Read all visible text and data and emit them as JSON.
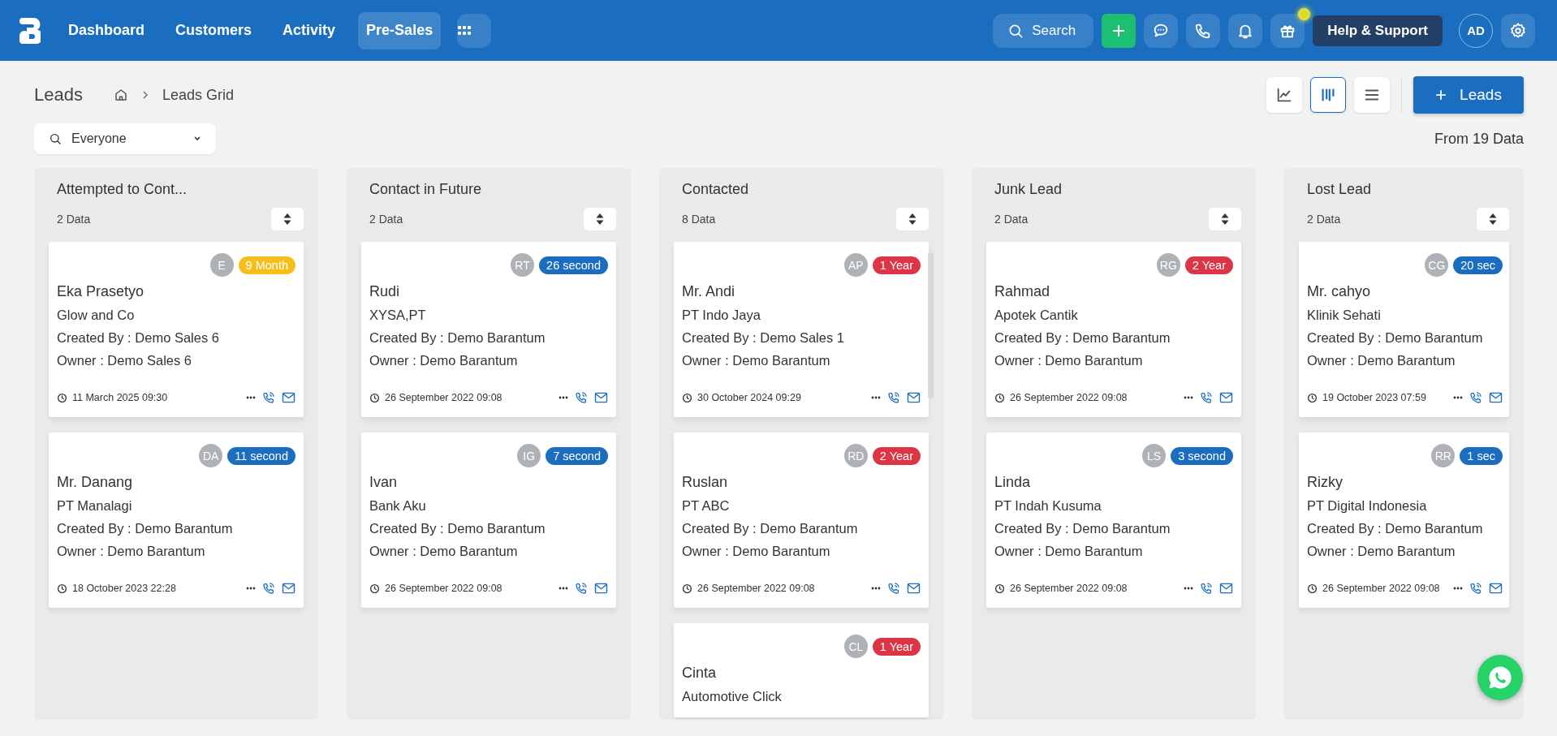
{
  "nav": {
    "items": [
      {
        "label": "Dashboard",
        "selected": false
      },
      {
        "label": "Customers",
        "selected": false
      },
      {
        "label": "Activity",
        "selected": false
      },
      {
        "label": "Pre-Sales",
        "selected": true
      }
    ]
  },
  "topbar": {
    "search_label": "Search",
    "help_label": "Help & Support",
    "avatar": "AD",
    "gift_notification": true
  },
  "page": {
    "title": "Leads",
    "breadcrumb": "Leads Grid"
  },
  "views": [
    {
      "kind": "chart",
      "selected": false
    },
    {
      "kind": "kanban",
      "selected": true
    },
    {
      "kind": "list",
      "selected": false
    }
  ],
  "add_button": "Leads",
  "filter": {
    "value": "Everyone"
  },
  "total": "From 19 Data",
  "columns": [
    {
      "title": "Attempted to Cont...",
      "count": "2 Data",
      "cards": [
        {
          "initials": "E",
          "age": "9 Month",
          "color": "#f5bf1b",
          "name": "Eka Prasetyo",
          "company": "Glow and Co",
          "created_by": "Created By : Demo Sales 6",
          "owner": "Owner : Demo Sales 6",
          "date": "11 March 2025 09:30"
        },
        {
          "initials": "DA",
          "age": "11 second",
          "color": "#1b6ebf",
          "name": "Mr. Danang",
          "company": "PT Manalagi",
          "created_by": "Created By : Demo Barantum",
          "owner": "Owner : Demo Barantum",
          "date": "18 October 2023 22:28"
        }
      ]
    },
    {
      "title": "Contact in Future",
      "count": "2 Data",
      "cards": [
        {
          "initials": "RT",
          "age": "26 second",
          "color": "#1b6ebf",
          "name": "Rudi",
          "company": "XYSA,PT",
          "created_by": "Created By : Demo Barantum",
          "owner": "Owner : Demo Barantum",
          "date": "26 September 2022 09:08"
        },
        {
          "initials": "IG",
          "age": "7 second",
          "color": "#1b6ebf",
          "name": "Ivan",
          "company": "Bank Aku",
          "created_by": "Created By : Demo Barantum",
          "owner": "Owner : Demo Barantum",
          "date": "26 September 2022 09:08"
        }
      ]
    },
    {
      "title": "Contacted",
      "count": "8 Data",
      "cards": [
        {
          "initials": "AP",
          "age": "1 Year",
          "color": "#dc3545",
          "name": "Mr. Andi",
          "company": "PT Indo Jaya",
          "created_by": "Created By : Demo Sales 1",
          "owner": "Owner : Demo Barantum",
          "date": "30 October 2024 09:29"
        },
        {
          "initials": "RD",
          "age": "2 Year",
          "color": "#dc3545",
          "name": "Ruslan",
          "company": "PT ABC",
          "created_by": "Created By : Demo Barantum",
          "owner": "Owner : Demo Barantum",
          "date": "26 September 2022 09:08"
        },
        {
          "initials": "CL",
          "age": "1 Year",
          "color": "#dc3545",
          "name": "Cinta",
          "company": "Automotive Click"
        }
      ]
    },
    {
      "title": "Junk Lead",
      "count": "2 Data",
      "cards": [
        {
          "initials": "RG",
          "age": "2 Year",
          "color": "#dc3545",
          "name": "Rahmad",
          "company": "Apotek Cantik",
          "created_by": "Created By : Demo Barantum",
          "owner": "Owner : Demo Barantum",
          "date": "26 September 2022 09:08"
        },
        {
          "initials": "LS",
          "age": "3 second",
          "color": "#1b6ebf",
          "name": "Linda",
          "company": "PT Indah Kusuma",
          "created_by": "Created By : Demo Barantum",
          "owner": "Owner : Demo Barantum",
          "date": "26 September 2022 09:08"
        }
      ]
    },
    {
      "title": "Lost Lead",
      "count": "2 Data",
      "cards": [
        {
          "initials": "CG",
          "age": "20 sec",
          "color": "#1b6ebf",
          "name": "Mr. cahyo",
          "company": "Klinik Sehati",
          "created_by": "Created By : Demo Barantum",
          "owner": "Owner : Demo Barantum",
          "date": "19 October 2023 07:59"
        },
        {
          "initials": "RR",
          "age": "1 sec",
          "color": "#1b6ebf",
          "name": "Rizky",
          "company": "PT Digital Indonesia",
          "created_by": "Created By : Demo Barantum",
          "owner": "Owner : Demo Barantum",
          "date": "26 September 2022 09:08"
        }
      ]
    }
  ]
}
